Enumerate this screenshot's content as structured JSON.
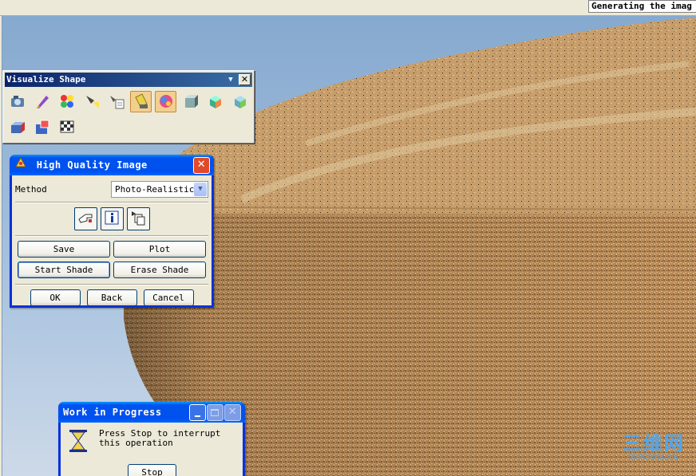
{
  "status_bar": {
    "message": "Generating the imag"
  },
  "visualize_toolbar": {
    "title": "Visualize Shape",
    "dropdown_glyph": "▼",
    "close_glyph": "✕",
    "row1": [
      "camera-icon",
      "paint-pen-icon",
      "color-palette-icon",
      "spotlight-icon",
      "light-editor-icon",
      "material-icon",
      "texture-ball-icon",
      "box-shade-icon",
      "cube-tools-icon",
      "cube-options-icon"
    ],
    "row2": [
      "clipboard-box-icon",
      "export-image-icon",
      "checker-icon"
    ]
  },
  "hq_dialog": {
    "title": "High Quality Image",
    "close_glyph": "✕",
    "method_label": "Method",
    "method_value": "Photo-Realistic",
    "dropdown_arrow": "▼",
    "icon_buttons": [
      "hand-point-icon",
      "info-icon",
      "sequence-icon"
    ],
    "save_label": "Save",
    "plot_label": "Plot",
    "start_shade_label": "Start Shade",
    "erase_shade_label": "Erase Shade",
    "ok_label": "OK",
    "back_label": "Back",
    "cancel_label": "Cancel"
  },
  "wip_dialog": {
    "title": "Work in Progress",
    "message_line1": "Press Stop to interrupt",
    "message_line2": "this operation",
    "stop_label": "Stop"
  },
  "watermark": {
    "logo_text": "三维网",
    "sub_text": "3DPORTAL.CN"
  },
  "colors": {
    "title_blue": "#0054e3",
    "close_red": "#e04a2a",
    "sky": "#a7c2df",
    "wood": "#b98b58"
  }
}
